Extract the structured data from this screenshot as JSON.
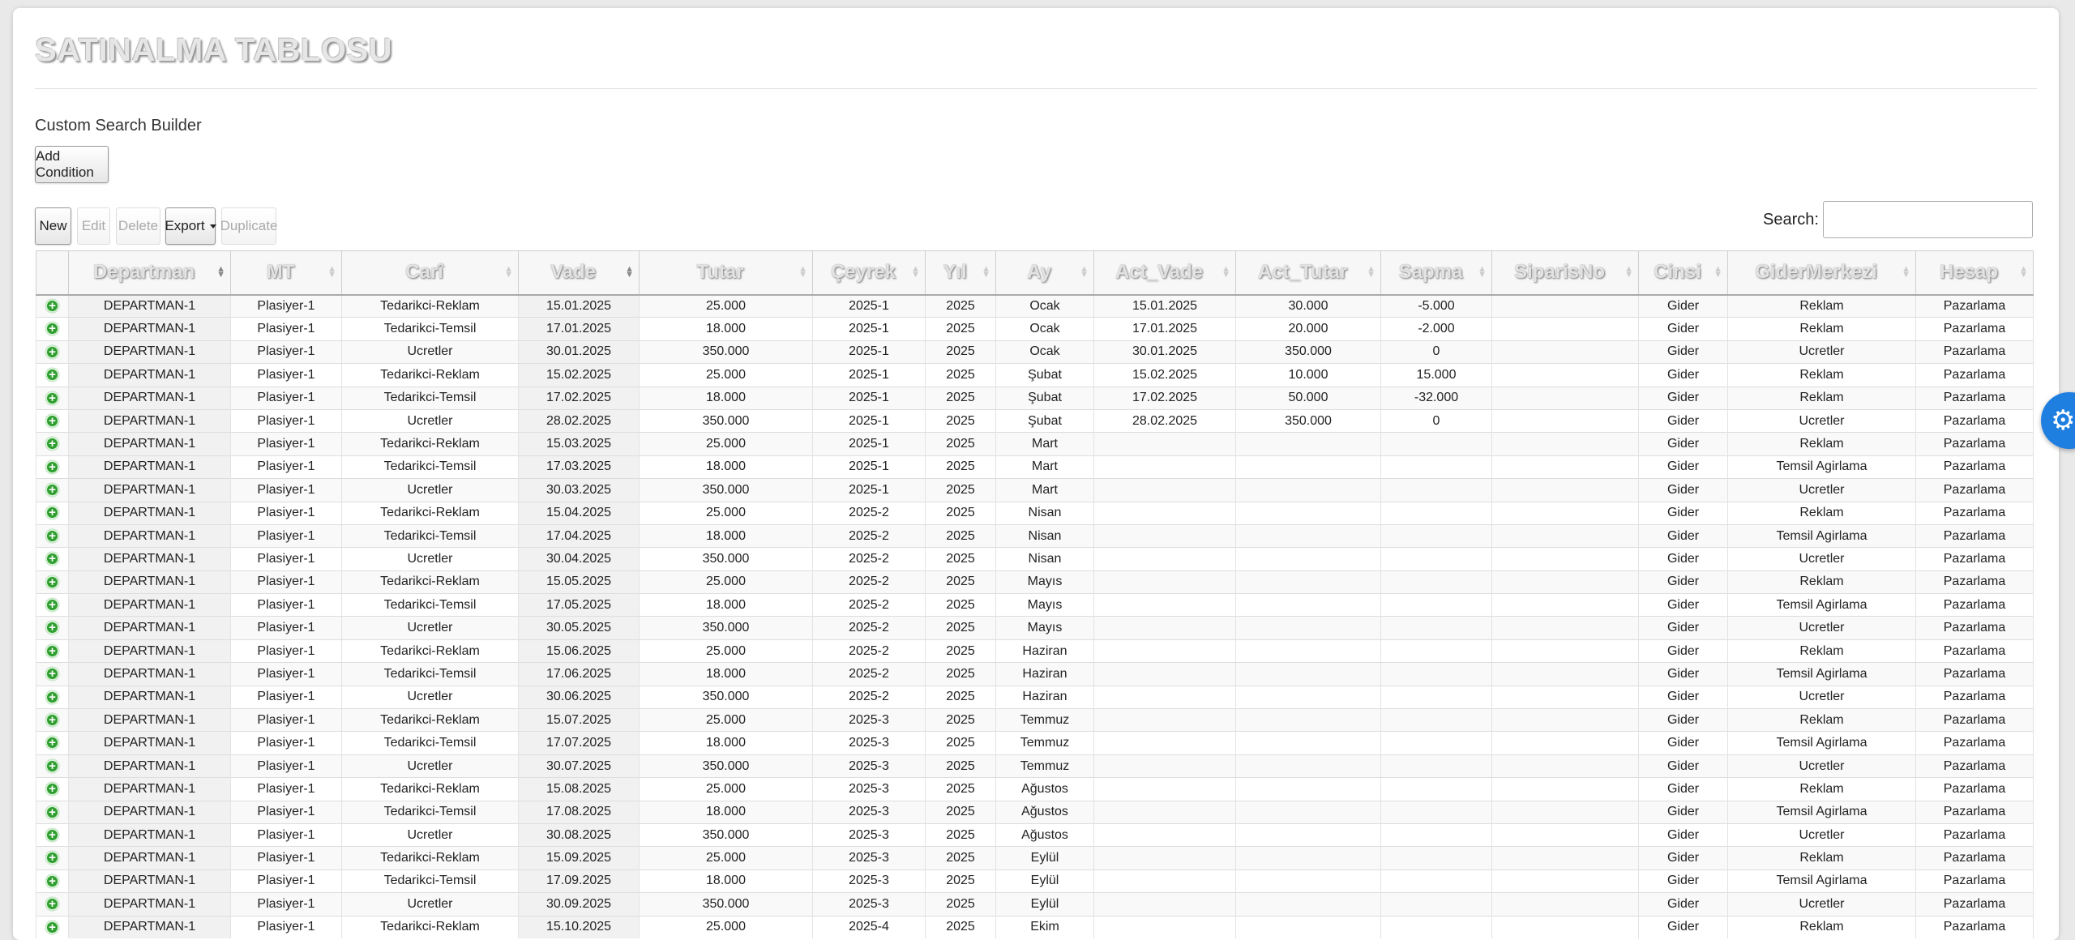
{
  "title": "SATINALMA TABLOSU",
  "search_builder": {
    "title": "Custom Search Builder",
    "add_condition": "Add Condition"
  },
  "toolbar": {
    "new": "New",
    "edit": "Edit",
    "delete": "Delete",
    "export": "Export",
    "duplicate": "Duplicate"
  },
  "search": {
    "label": "Search:",
    "value": ""
  },
  "table": {
    "headers": [
      "",
      "Departman",
      "MT",
      "Carî",
      "Vade",
      "Tutar",
      "Çeyrek",
      "Yıl",
      "Ay",
      "Act_Vade",
      "Act_Tutar",
      "Sapma",
      "SiparisNo",
      "Cinsi",
      "GiderMerkezi",
      "Hesap"
    ],
    "rows": [
      [
        "DEPARTMAN-1",
        "Plasiyer-1",
        "Tedarikci-Reklam",
        "15.01.2025",
        "25.000",
        "2025-1",
        "2025",
        "Ocak",
        "15.01.2025",
        "30.000",
        "-5.000",
        "",
        "Gider",
        "Reklam",
        "Pazarlama"
      ],
      [
        "DEPARTMAN-1",
        "Plasiyer-1",
        "Tedarikci-Temsil",
        "17.01.2025",
        "18.000",
        "2025-1",
        "2025",
        "Ocak",
        "17.01.2025",
        "20.000",
        "-2.000",
        "",
        "Gider",
        "Reklam",
        "Pazarlama"
      ],
      [
        "DEPARTMAN-1",
        "Plasiyer-1",
        "Ucretler",
        "30.01.2025",
        "350.000",
        "2025-1",
        "2025",
        "Ocak",
        "30.01.2025",
        "350.000",
        "0",
        "",
        "Gider",
        "Ucretler",
        "Pazarlama"
      ],
      [
        "DEPARTMAN-1",
        "Plasiyer-1",
        "Tedarikci-Reklam",
        "15.02.2025",
        "25.000",
        "2025-1",
        "2025",
        "Şubat",
        "15.02.2025",
        "10.000",
        "15.000",
        "",
        "Gider",
        "Reklam",
        "Pazarlama"
      ],
      [
        "DEPARTMAN-1",
        "Plasiyer-1",
        "Tedarikci-Temsil",
        "17.02.2025",
        "18.000",
        "2025-1",
        "2025",
        "Şubat",
        "17.02.2025",
        "50.000",
        "-32.000",
        "",
        "Gider",
        "Reklam",
        "Pazarlama"
      ],
      [
        "DEPARTMAN-1",
        "Plasiyer-1",
        "Ucretler",
        "28.02.2025",
        "350.000",
        "2025-1",
        "2025",
        "Şubat",
        "28.02.2025",
        "350.000",
        "0",
        "",
        "Gider",
        "Ucretler",
        "Pazarlama"
      ],
      [
        "DEPARTMAN-1",
        "Plasiyer-1",
        "Tedarikci-Reklam",
        "15.03.2025",
        "25.000",
        "2025-1",
        "2025",
        "Mart",
        "",
        "",
        "",
        "",
        "Gider",
        "Reklam",
        "Pazarlama"
      ],
      [
        "DEPARTMAN-1",
        "Plasiyer-1",
        "Tedarikci-Temsil",
        "17.03.2025",
        "18.000",
        "2025-1",
        "2025",
        "Mart",
        "",
        "",
        "",
        "",
        "Gider",
        "Temsil Agirlama",
        "Pazarlama"
      ],
      [
        "DEPARTMAN-1",
        "Plasiyer-1",
        "Ucretler",
        "30.03.2025",
        "350.000",
        "2025-1",
        "2025",
        "Mart",
        "",
        "",
        "",
        "",
        "Gider",
        "Ucretler",
        "Pazarlama"
      ],
      [
        "DEPARTMAN-1",
        "Plasiyer-1",
        "Tedarikci-Reklam",
        "15.04.2025",
        "25.000",
        "2025-2",
        "2025",
        "Nisan",
        "",
        "",
        "",
        "",
        "Gider",
        "Reklam",
        "Pazarlama"
      ],
      [
        "DEPARTMAN-1",
        "Plasiyer-1",
        "Tedarikci-Temsil",
        "17.04.2025",
        "18.000",
        "2025-2",
        "2025",
        "Nisan",
        "",
        "",
        "",
        "",
        "Gider",
        "Temsil Agirlama",
        "Pazarlama"
      ],
      [
        "DEPARTMAN-1",
        "Plasiyer-1",
        "Ucretler",
        "30.04.2025",
        "350.000",
        "2025-2",
        "2025",
        "Nisan",
        "",
        "",
        "",
        "",
        "Gider",
        "Ucretler",
        "Pazarlama"
      ],
      [
        "DEPARTMAN-1",
        "Plasiyer-1",
        "Tedarikci-Reklam",
        "15.05.2025",
        "25.000",
        "2025-2",
        "2025",
        "Mayıs",
        "",
        "",
        "",
        "",
        "Gider",
        "Reklam",
        "Pazarlama"
      ],
      [
        "DEPARTMAN-1",
        "Plasiyer-1",
        "Tedarikci-Temsil",
        "17.05.2025",
        "18.000",
        "2025-2",
        "2025",
        "Mayıs",
        "",
        "",
        "",
        "",
        "Gider",
        "Temsil Agirlama",
        "Pazarlama"
      ],
      [
        "DEPARTMAN-1",
        "Plasiyer-1",
        "Ucretler",
        "30.05.2025",
        "350.000",
        "2025-2",
        "2025",
        "Mayıs",
        "",
        "",
        "",
        "",
        "Gider",
        "Ucretler",
        "Pazarlama"
      ],
      [
        "DEPARTMAN-1",
        "Plasiyer-1",
        "Tedarikci-Reklam",
        "15.06.2025",
        "25.000",
        "2025-2",
        "2025",
        "Haziran",
        "",
        "",
        "",
        "",
        "Gider",
        "Reklam",
        "Pazarlama"
      ],
      [
        "DEPARTMAN-1",
        "Plasiyer-1",
        "Tedarikci-Temsil",
        "17.06.2025",
        "18.000",
        "2025-2",
        "2025",
        "Haziran",
        "",
        "",
        "",
        "",
        "Gider",
        "Temsil Agirlama",
        "Pazarlama"
      ],
      [
        "DEPARTMAN-1",
        "Plasiyer-1",
        "Ucretler",
        "30.06.2025",
        "350.000",
        "2025-2",
        "2025",
        "Haziran",
        "",
        "",
        "",
        "",
        "Gider",
        "Ucretler",
        "Pazarlama"
      ],
      [
        "DEPARTMAN-1",
        "Plasiyer-1",
        "Tedarikci-Reklam",
        "15.07.2025",
        "25.000",
        "2025-3",
        "2025",
        "Temmuz",
        "",
        "",
        "",
        "",
        "Gider",
        "Reklam",
        "Pazarlama"
      ],
      [
        "DEPARTMAN-1",
        "Plasiyer-1",
        "Tedarikci-Temsil",
        "17.07.2025",
        "18.000",
        "2025-3",
        "2025",
        "Temmuz",
        "",
        "",
        "",
        "",
        "Gider",
        "Temsil Agirlama",
        "Pazarlama"
      ],
      [
        "DEPARTMAN-1",
        "Plasiyer-1",
        "Ucretler",
        "30.07.2025",
        "350.000",
        "2025-3",
        "2025",
        "Temmuz",
        "",
        "",
        "",
        "",
        "Gider",
        "Ucretler",
        "Pazarlama"
      ],
      [
        "DEPARTMAN-1",
        "Plasiyer-1",
        "Tedarikci-Reklam",
        "15.08.2025",
        "25.000",
        "2025-3",
        "2025",
        "Ağustos",
        "",
        "",
        "",
        "",
        "Gider",
        "Reklam",
        "Pazarlama"
      ],
      [
        "DEPARTMAN-1",
        "Plasiyer-1",
        "Tedarikci-Temsil",
        "17.08.2025",
        "18.000",
        "2025-3",
        "2025",
        "Ağustos",
        "",
        "",
        "",
        "",
        "Gider",
        "Temsil Agirlama",
        "Pazarlama"
      ],
      [
        "DEPARTMAN-1",
        "Plasiyer-1",
        "Ucretler",
        "30.08.2025",
        "350.000",
        "2025-3",
        "2025",
        "Ağustos",
        "",
        "",
        "",
        "",
        "Gider",
        "Ucretler",
        "Pazarlama"
      ],
      [
        "DEPARTMAN-1",
        "Plasiyer-1",
        "Tedarikci-Reklam",
        "15.09.2025",
        "25.000",
        "2025-3",
        "2025",
        "Eylül",
        "",
        "",
        "",
        "",
        "Gider",
        "Reklam",
        "Pazarlama"
      ],
      [
        "DEPARTMAN-1",
        "Plasiyer-1",
        "Tedarikci-Temsil",
        "17.09.2025",
        "18.000",
        "2025-3",
        "2025",
        "Eylül",
        "",
        "",
        "",
        "",
        "Gider",
        "Temsil Agirlama",
        "Pazarlama"
      ],
      [
        "DEPARTMAN-1",
        "Plasiyer-1",
        "Ucretler",
        "30.09.2025",
        "350.000",
        "2025-3",
        "2025",
        "Eylül",
        "",
        "",
        "",
        "",
        "Gider",
        "Ucretler",
        "Pazarlama"
      ],
      [
        "DEPARTMAN-1",
        "Plasiyer-1",
        "Tedarikci-Reklam",
        "15.10.2025",
        "25.000",
        "2025-4",
        "2025",
        "Ekim",
        "",
        "",
        "",
        "",
        "Gider",
        "Reklam",
        "Pazarlama"
      ]
    ]
  },
  "icons": {
    "row_expand": "plus-circle-icon",
    "settings": "gear-icon"
  },
  "colors": {
    "expand_green": "#2e9e2e",
    "fab_blue": "#1e7fe0"
  }
}
